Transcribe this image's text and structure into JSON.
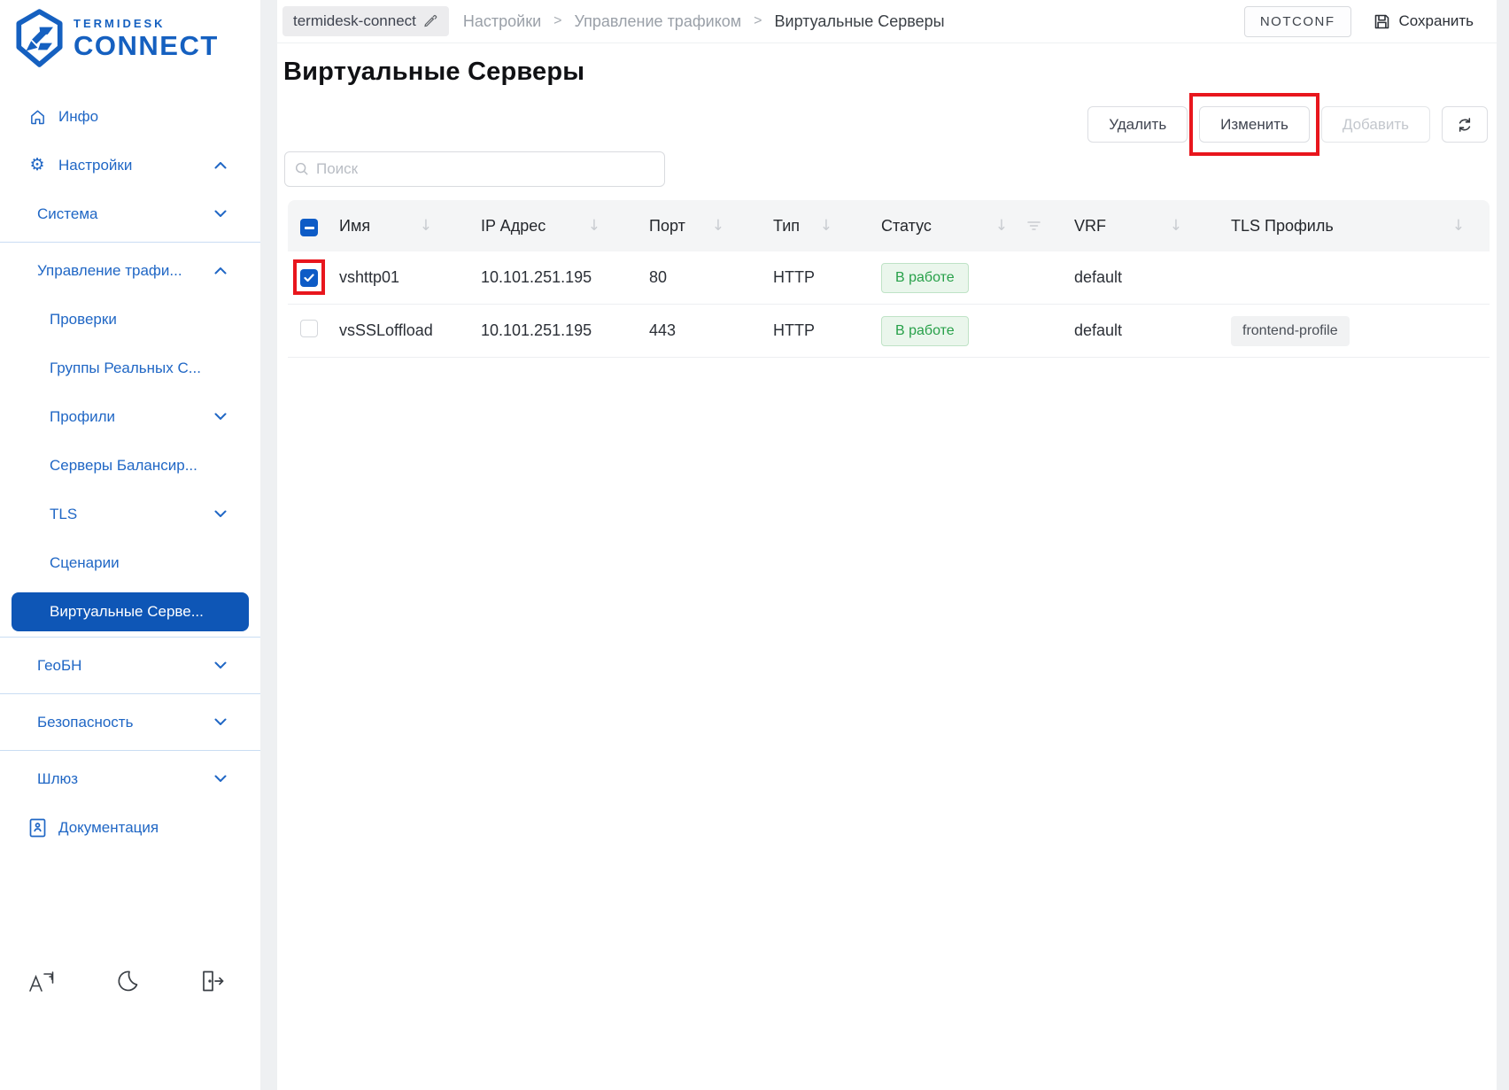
{
  "brand": {
    "line1": "TERMIDESK",
    "line2": "CONNECT"
  },
  "colors": {
    "brand_blue": "#1560c0",
    "active_item_bg": "#0e56b6",
    "annotation_red": "#e8161d",
    "status_green": "#27a049",
    "status_green_bg": "#eaf6ec"
  },
  "sidebar": {
    "items": [
      {
        "id": "info",
        "label": "Инфо",
        "icon": "home-icon",
        "level": 0
      },
      {
        "id": "settings",
        "label": "Настройки",
        "icon": "gear-icon",
        "level": 0,
        "chevron": "up"
      },
      {
        "id": "system",
        "label": "Система",
        "level": 1,
        "chevron": "down"
      },
      {
        "divider": true
      },
      {
        "id": "traffic-management",
        "label": "Управление трафи...",
        "level": 1,
        "chevron": "up"
      },
      {
        "id": "checks",
        "label": "Проверки",
        "level": 2
      },
      {
        "id": "real-server-groups",
        "label": "Группы Реальных С...",
        "level": 2
      },
      {
        "id": "profiles",
        "label": "Профили",
        "level": 2,
        "chevron": "down"
      },
      {
        "id": "balancer-servers",
        "label": "Серверы Балансир...",
        "level": 2
      },
      {
        "id": "tls",
        "label": "TLS",
        "level": 2,
        "chevron": "down"
      },
      {
        "id": "scenarios",
        "label": "Сценарии",
        "level": 2
      },
      {
        "id": "virtual-servers",
        "label": "Виртуальные Серве...",
        "level": 2,
        "active": true
      },
      {
        "divider": true
      },
      {
        "id": "geobn",
        "label": "ГеоБН",
        "level": 1,
        "chevron": "down"
      },
      {
        "divider": true
      },
      {
        "id": "security",
        "label": "Безопасность",
        "level": 1,
        "chevron": "down"
      },
      {
        "divider": true
      },
      {
        "id": "gateway",
        "label": "Шлюз",
        "level": 1,
        "chevron": "down"
      },
      {
        "id": "documentation",
        "label": "Документация",
        "icon": "book-icon",
        "level": 0
      }
    ],
    "footer_icons": [
      {
        "icon": "language-icon"
      },
      {
        "icon": "moon-icon"
      },
      {
        "icon": "logout-icon"
      }
    ]
  },
  "topbar": {
    "device_name": "termidesk-connect",
    "separator": ">",
    "breadcrumbs": [
      "Настройки",
      "Управление трафиком",
      "Виртуальные Серверы"
    ],
    "status_badge": "NOTCONF",
    "save_label": "Сохранить"
  },
  "page": {
    "title": "Виртуальные Серверы",
    "search_placeholder": "Поиск",
    "actions": {
      "delete": "Удалить",
      "edit": "Изменить",
      "add": "Добавить",
      "edit_annotated": true
    }
  },
  "table": {
    "headers": [
      "Имя",
      "IP Адрес",
      "Порт",
      "Тип",
      "Статус",
      "VRF",
      "TLS Профиль"
    ],
    "rows": [
      {
        "checked": true,
        "annotated": true,
        "name": "vshttp01",
        "ip": "10.101.251.195",
        "port": "80",
        "type": "HTTP",
        "status": "В работе",
        "vrf": "default",
        "tls_profile": ""
      },
      {
        "checked": false,
        "annotated": false,
        "name": "vsSSLoffload",
        "ip": "10.101.251.195",
        "port": "443",
        "type": "HTTP",
        "status": "В работе",
        "vrf": "default",
        "tls_profile": "frontend-profile"
      }
    ]
  }
}
